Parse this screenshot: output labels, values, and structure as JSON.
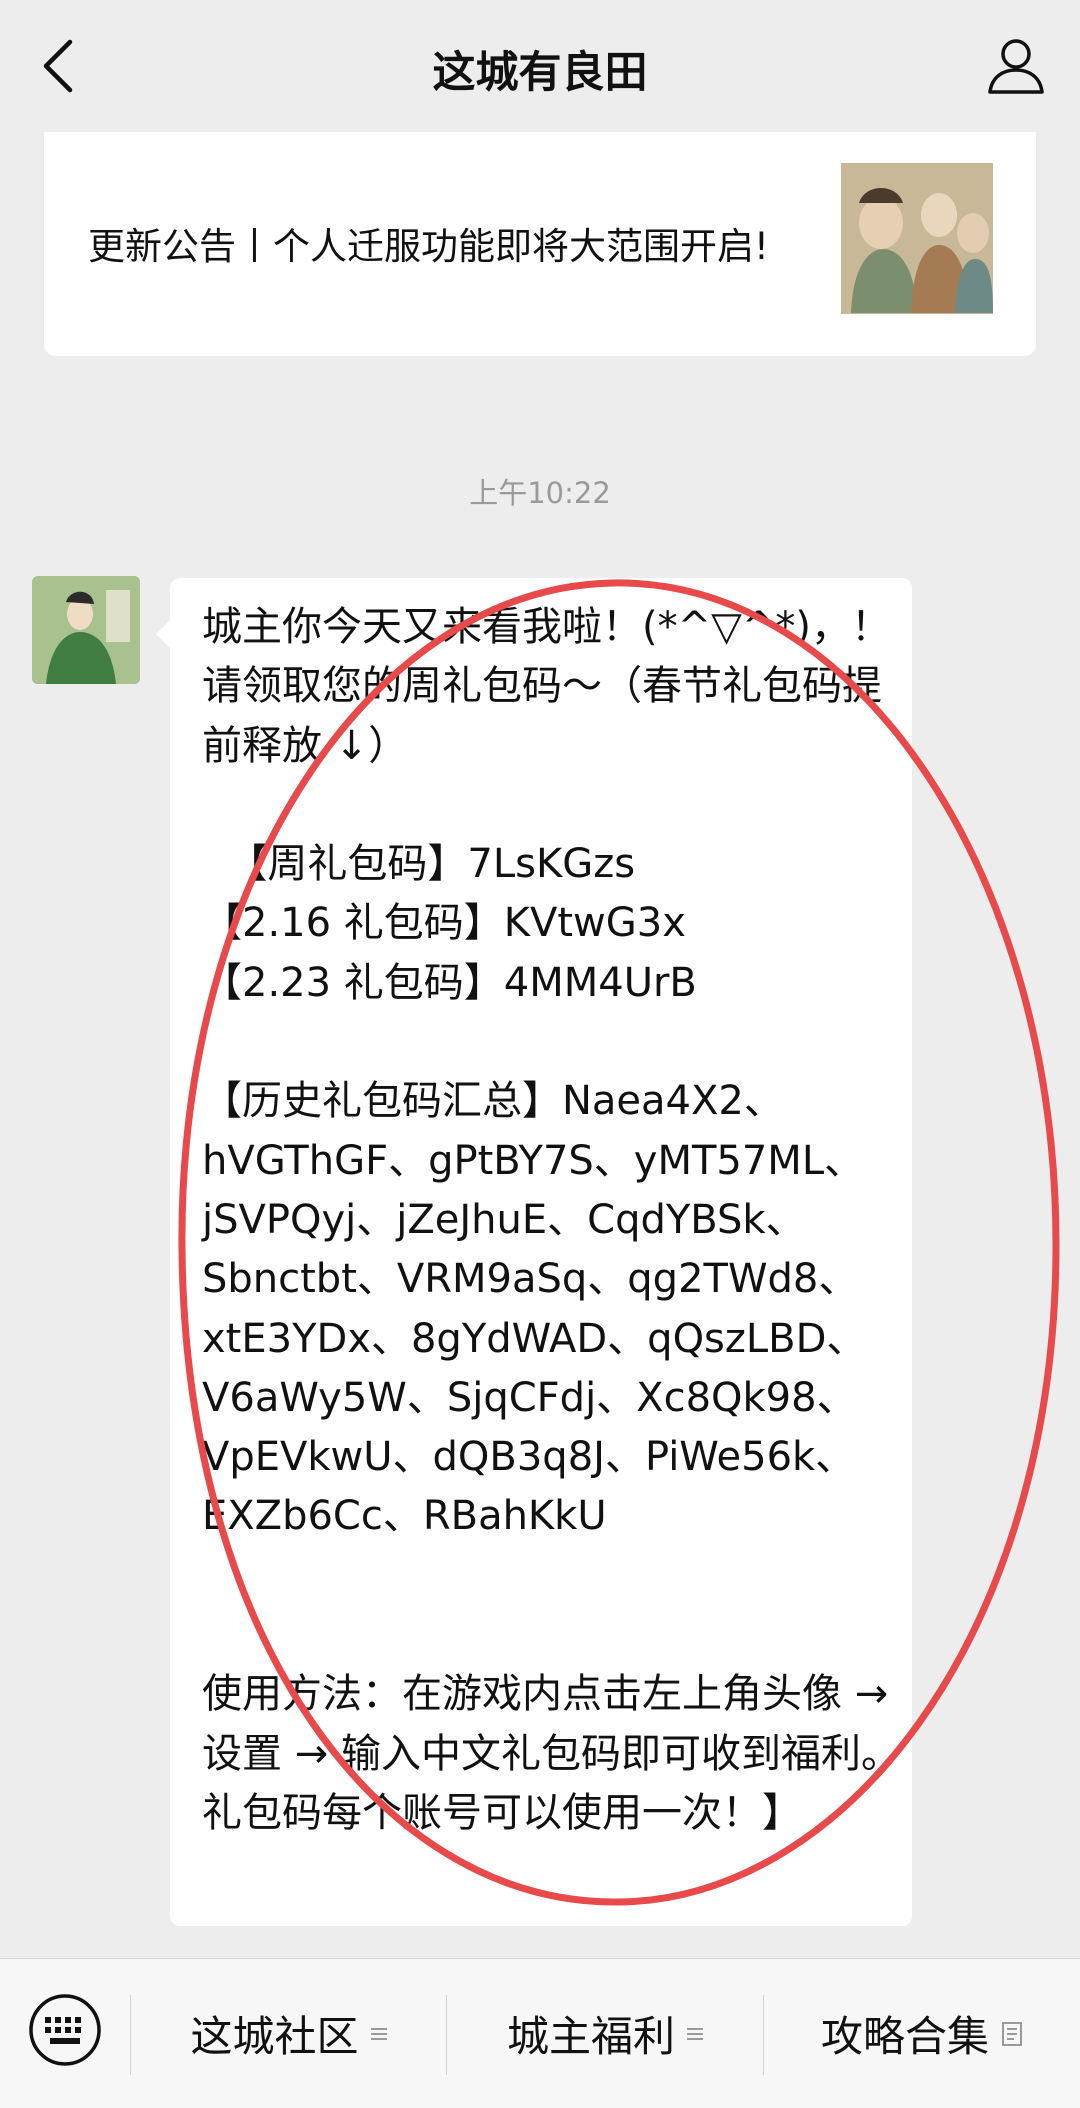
{
  "header": {
    "title": "这城有良田"
  },
  "article": {
    "title": "更新公告丨个人迁服功能即将大范围开启!"
  },
  "timestamp": "上午10:22",
  "message": {
    "text": "城主你今天又来看我啦！(*^▽^*)，！请领取您的周礼包码～（春节礼包码提前释放 ↓）\n\n  【周礼包码】7LsKGzs\n【2.16 礼包码】KVtwG3x\n【2.23 礼包码】4MM4UrB\n\n【历史礼包码汇总】Naea4X2、hVGThGF、gPtBY7S、yMT57ML、jSVPQyj、jZeJhuE、CqdYBSk、Sbnctbt、VRM9aSq、qg2TWd8、xtE3YDx、8gYdWAD、qQszLBD、V6aWy5W、SjqCFdj、Xc8Qk98、VpEVkwU、dQB3q8J、PiWe56k、EXZb6Cc、RBahKkU\n\n\n使用方法：在游戏内点击左上角头像 → 设置 → 输入中文礼包码即可收到福利。礼包码每个账号可以使用一次！】"
  },
  "annotation_color": "#e8494a",
  "bottom_menu": {
    "items": [
      {
        "label": "这城社区",
        "icon": "menu-lines-icon"
      },
      {
        "label": "城主福利",
        "icon": "menu-lines-icon"
      },
      {
        "label": "攻略合集",
        "icon": "article-icon"
      }
    ]
  }
}
